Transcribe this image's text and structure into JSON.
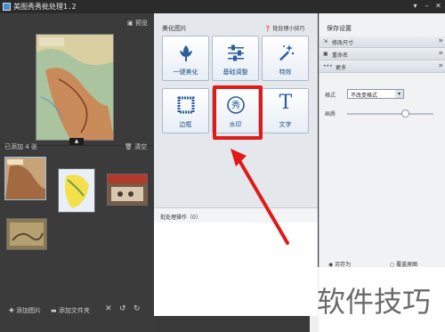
{
  "window": {
    "title": "美图秀秀批处理1.2"
  },
  "left_panel": {
    "preview_label": "预览",
    "added_count_label": "已添加 4 张",
    "clear_label": "清空",
    "add_image_label": "添加图片",
    "add_folder_label": "添加文件夹"
  },
  "center_panel": {
    "section_title": "美化图片",
    "tips_label": "批处理小技巧",
    "tools": [
      {
        "label": "一键美化",
        "icon": "flower-icon"
      },
      {
        "label": "基础调整",
        "icon": "sliders-icon"
      },
      {
        "label": "特效",
        "icon": "magic-wand-icon"
      },
      {
        "label": "边框",
        "icon": "frame-icon"
      },
      {
        "label": "水印",
        "icon": "watermark-icon",
        "glyph": "秀"
      },
      {
        "label": "文字",
        "icon": "text-icon",
        "glyph": "T"
      }
    ],
    "batch_ops_label": "批处理操作（0）"
  },
  "right_panel": {
    "section_title": "保存设置",
    "rows": [
      {
        "label": "修改尺寸"
      },
      {
        "label": "重命名"
      },
      {
        "label": "更多"
      }
    ],
    "format_label": "格式",
    "format_value": "不改变格式",
    "quality_label": "画质",
    "save_as_label": "另存为",
    "overwrite_label": "覆盖原图"
  },
  "watermark_text": "软件技巧",
  "colors": {
    "highlight": "#e11919",
    "accent": "#1b4f86"
  }
}
